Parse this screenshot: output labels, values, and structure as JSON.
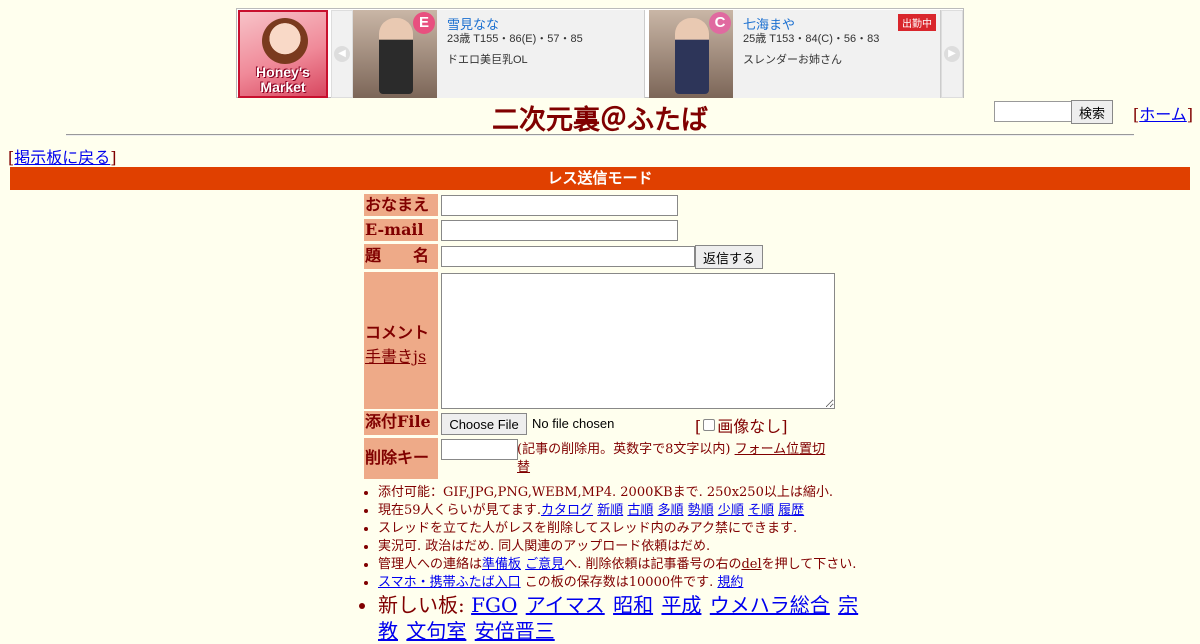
{
  "banner": {
    "logo_line1": "Honey's",
    "logo_line2": "Market",
    "left_arrow": "◀",
    "right_arrow": "▶",
    "cards": [
      {
        "badge": "E",
        "name": "雪見なな",
        "stats": "23歳 T155・86(E)・57・85",
        "desc": "ドエロ美巨乳OL",
        "status": ""
      },
      {
        "badge": "C",
        "name": "七海まや",
        "stats": "25歳 T153・84(C)・56・83",
        "desc": "スレンダーお姉さん",
        "status": "出勤中"
      }
    ]
  },
  "header": {
    "title": "二次元裏＠ふたば",
    "search_button": "検索",
    "home_link": "ホーム",
    "back_link": "掲示板に戻る"
  },
  "mode_bar": "レス送信モード",
  "form": {
    "name_label": "おなまえ",
    "email_label": "E-mail",
    "subject_label": "題　　名",
    "submit_button": "返信する",
    "comment_label": "コメント",
    "handwriting_link": "手書きjs",
    "file_label": "添付File",
    "file_button": "Choose File",
    "file_status": "No file chosen",
    "noimage_label": "画像なし",
    "delete_label": "削除キー",
    "delete_note": "(記事の削除用。英数字で8文字以内)",
    "form_position_link": "フォーム位置切替"
  },
  "notes": {
    "line1": "添付可能：GIF,JPG,PNG,WEBM,MP4. 2000KBまで. 250x250以上は縮小.",
    "line2_prefix": "現在59人くらいが見てます.",
    "line2_links": [
      "カタログ",
      "新順",
      "古順",
      "多順",
      "勢順",
      "少順",
      "そ順",
      "履歴"
    ],
    "line3": "スレッドを立てた人がレスを削除してスレッド内のみアク禁にできます.",
    "line4": "実況可. 政治はだめ. 同人関連のアップロード依頼はだめ.",
    "line5_prefix": "管理人への連絡は",
    "line5_link1": "準備板",
    "line5_link2": "ご意見",
    "line5_middle": "へ. 削除依頼は記事番号の右の",
    "line5_del": "del",
    "line5_suffix": "を押して下さい.",
    "line6_link": "スマホ・携帯ふたば入口",
    "line6_middle": " この板の保存数は10000件です. ",
    "line6_rules": "規約",
    "boards_label": "新しい板:",
    "boards": [
      "FGO",
      "アイマス",
      "昭和",
      "平成",
      "ウメハラ総合",
      "宗教",
      "文句室",
      "安倍晋三"
    ]
  }
}
